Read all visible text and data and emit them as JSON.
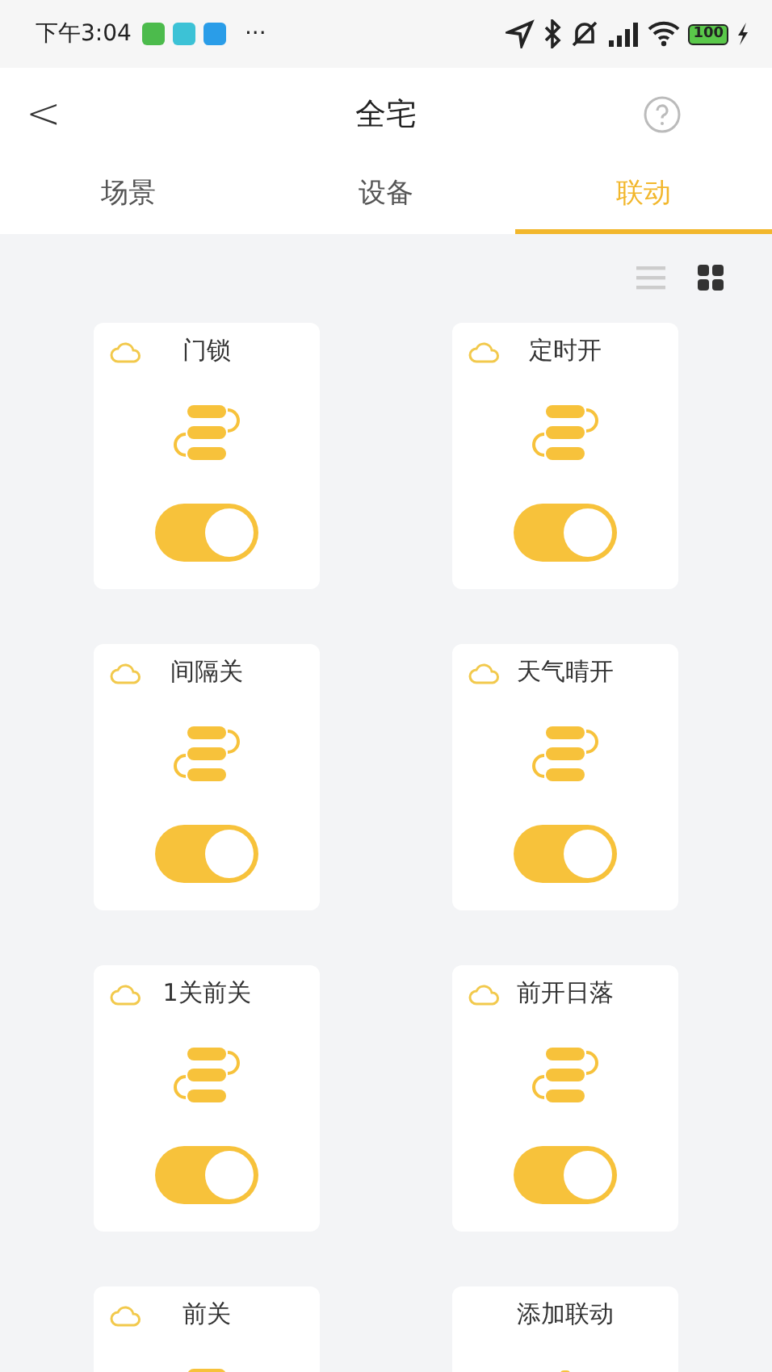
{
  "status_bar": {
    "time": "下午3:04",
    "more": "···",
    "battery": "100"
  },
  "header": {
    "back": "<",
    "title": "全宅"
  },
  "tabs": [
    {
      "label": "场景",
      "selected": false
    },
    {
      "label": "设备",
      "selected": false
    },
    {
      "label": "联动",
      "selected": true
    }
  ],
  "view_modes": [
    {
      "kind": "list",
      "selected": false
    },
    {
      "kind": "grid",
      "selected": true
    }
  ],
  "cards": [
    {
      "kind": "linkage",
      "name": "门锁",
      "on": true
    },
    {
      "kind": "linkage",
      "name": "定时开",
      "on": true
    },
    {
      "kind": "linkage",
      "name": "间隔关",
      "on": true
    },
    {
      "kind": "linkage",
      "name": "天气晴开",
      "on": true
    },
    {
      "kind": "linkage",
      "name": "1关前关",
      "on": true
    },
    {
      "kind": "linkage",
      "name": "前开日落",
      "on": true
    },
    {
      "kind": "linkage",
      "name": "前关"
    },
    {
      "kind": "add",
      "name": "添加联动"
    }
  ]
}
